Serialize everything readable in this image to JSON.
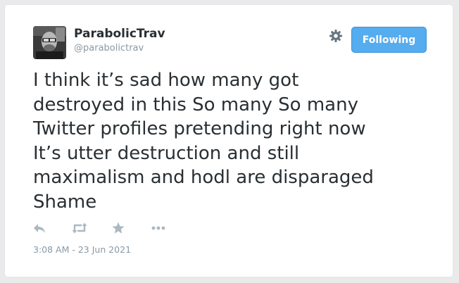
{
  "user": {
    "display_name": "ParabolicTrav",
    "handle": "@parabolictrav",
    "avatar_icon": "user-avatar-photo"
  },
  "header": {
    "settings_icon": "gear-icon",
    "follow_button_label": "Following"
  },
  "tweet": {
    "text": "I think it’s sad how many got\ndestroyed in this So many So many\nTwitter profiles pretending right now\nIt’s utter destruction and still\nmaximalism and hodl are disparaged\nShame",
    "timestamp": "3:08 AM - 23 Jun 2021"
  },
  "actions": [
    {
      "name": "reply",
      "icon": "reply-icon"
    },
    {
      "name": "retweet",
      "icon": "retweet-icon"
    },
    {
      "name": "like",
      "icon": "star-icon"
    },
    {
      "name": "more",
      "icon": "more-icon"
    }
  ],
  "colors": {
    "accent": "#55acee",
    "text": "#292f33",
    "muted": "#8899a6",
    "icon": "#aab8c2"
  }
}
